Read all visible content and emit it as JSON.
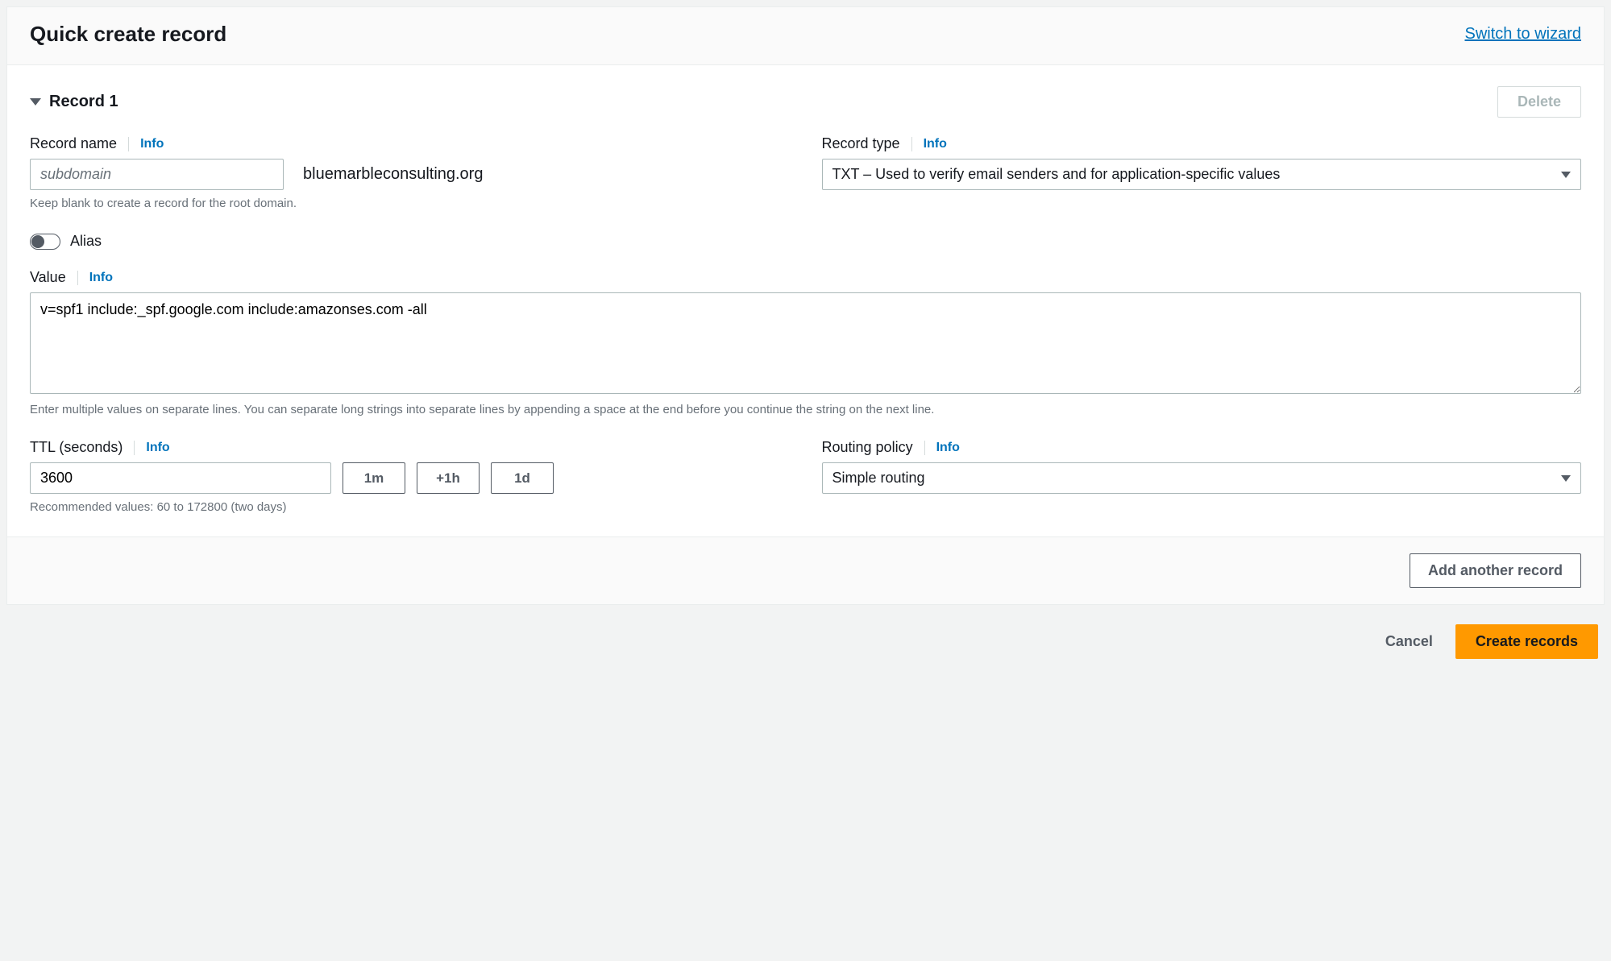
{
  "header": {
    "title": "Quick create record",
    "wizard_link": "Switch to wizard"
  },
  "record": {
    "title": "Record 1",
    "delete_label": "Delete",
    "name": {
      "label": "Record name",
      "info": "Info",
      "placeholder": "subdomain",
      "value": "",
      "domain_suffix": "bluemarbleconsulting.org",
      "help": "Keep blank to create a record for the root domain."
    },
    "type": {
      "label": "Record type",
      "info": "Info",
      "selected": "TXT – Used to verify email senders and for application-specific values"
    },
    "alias": {
      "label": "Alias",
      "on": false
    },
    "value": {
      "label": "Value",
      "info": "Info",
      "text": "v=spf1 include:_spf.google.com include:amazonses.com -all",
      "help": "Enter multiple values on separate lines. You can separate long strings into separate lines by appending a space at the end before you continue the string on the next line."
    },
    "ttl": {
      "label": "TTL (seconds)",
      "info": "Info",
      "value": "3600",
      "btn_1m": "1m",
      "btn_1h": "+1h",
      "btn_1d": "1d",
      "help": "Recommended values: 60 to 172800 (two days)"
    },
    "routing": {
      "label": "Routing policy",
      "info": "Info",
      "selected": "Simple routing"
    }
  },
  "footer": {
    "add_another": "Add another record"
  },
  "actions": {
    "cancel": "Cancel",
    "create": "Create records"
  }
}
